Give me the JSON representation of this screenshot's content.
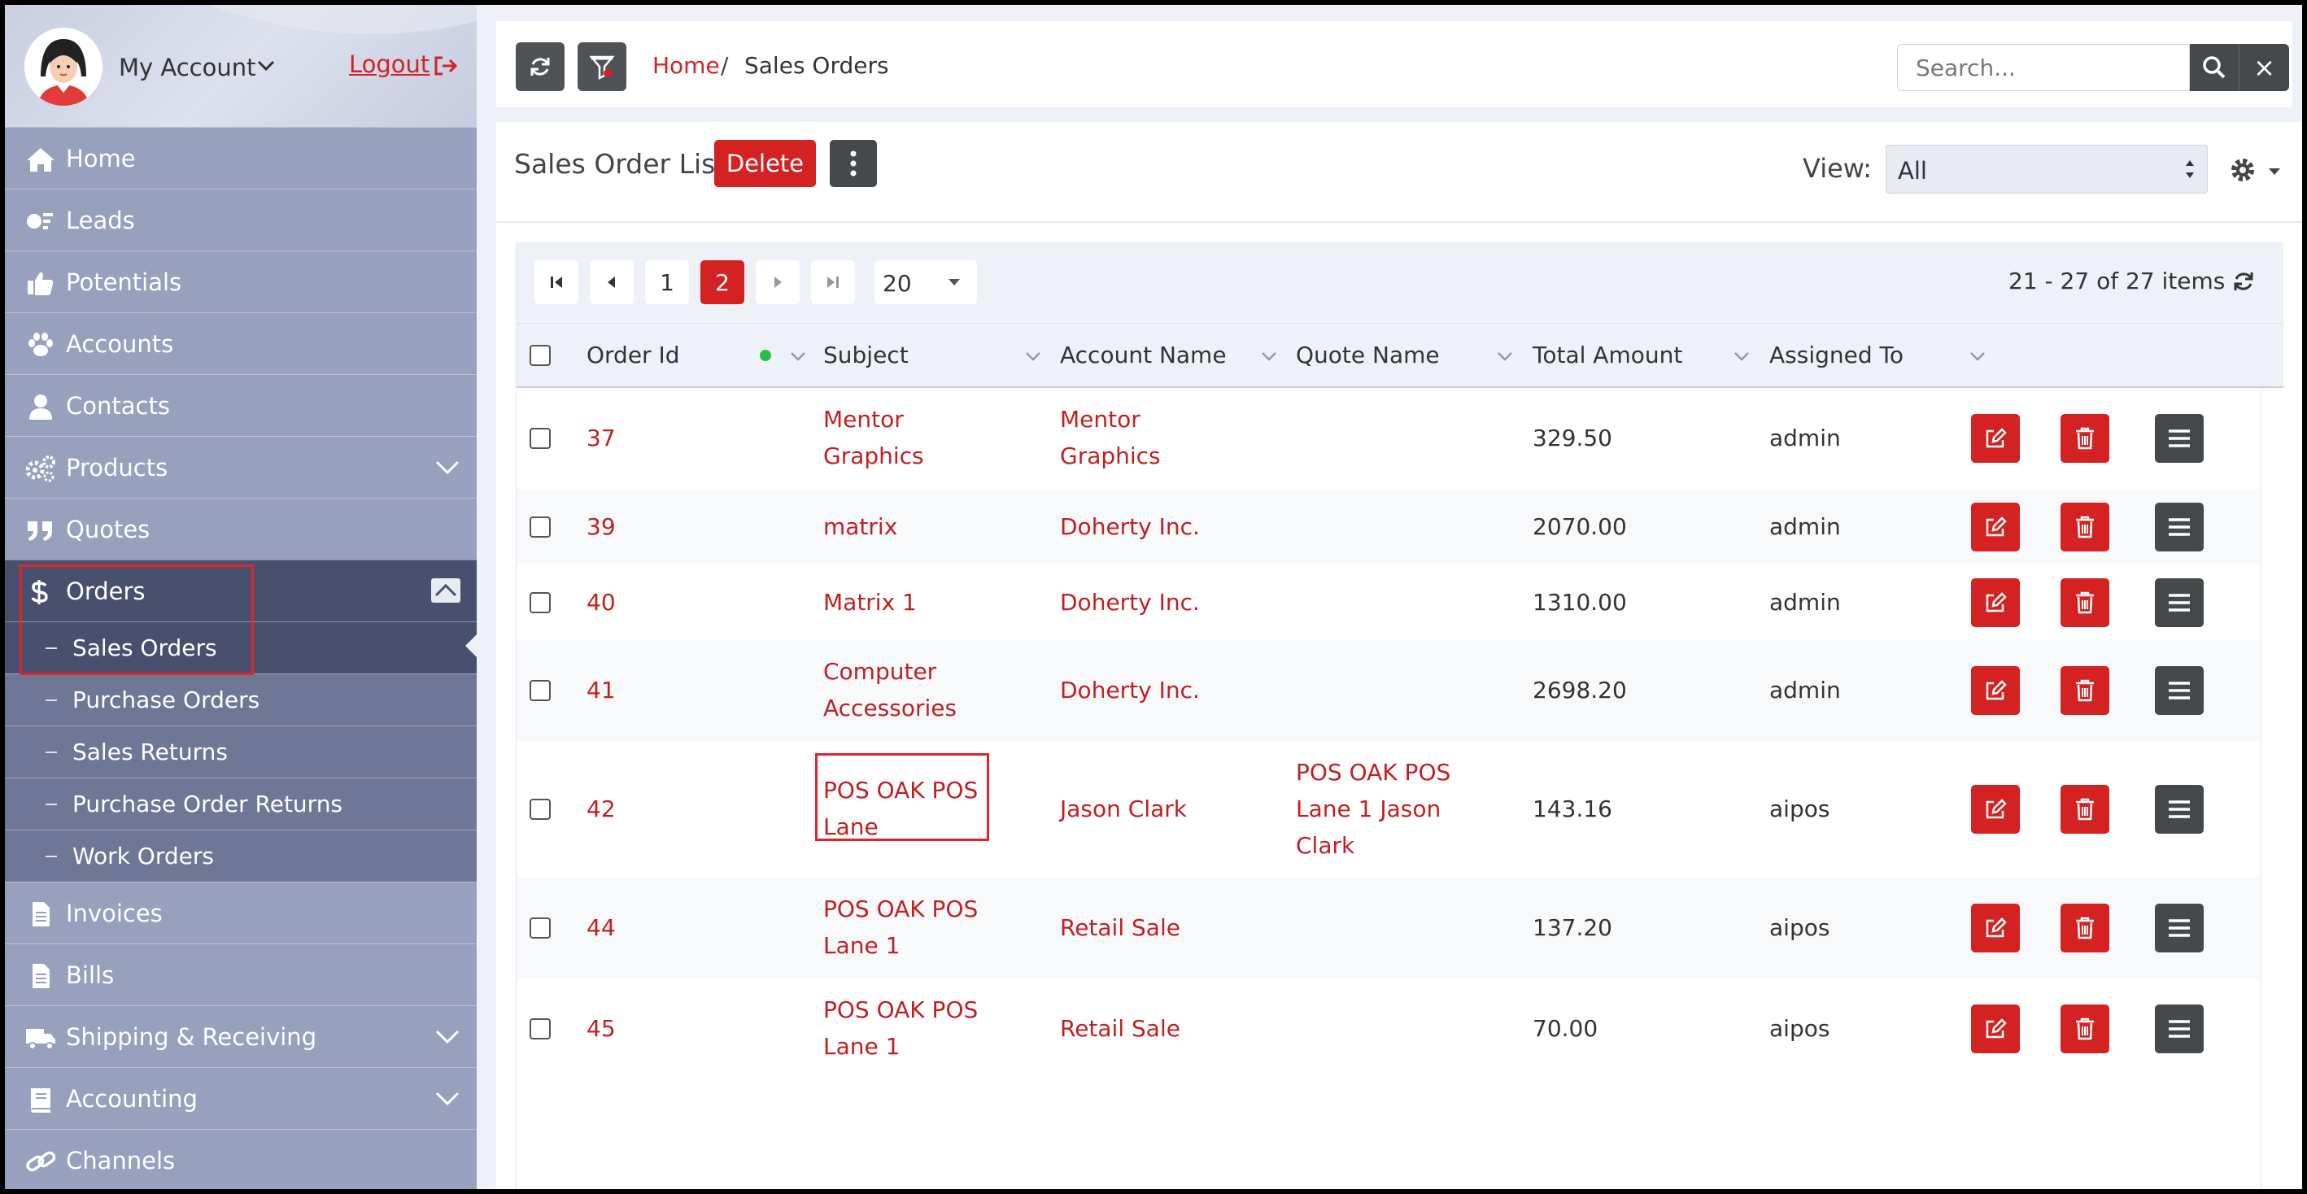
{
  "account": {
    "name": "My Account",
    "logout": "Logout"
  },
  "sidebar": {
    "items": [
      {
        "label": "Home"
      },
      {
        "label": "Leads"
      },
      {
        "label": "Potentials"
      },
      {
        "label": "Accounts"
      },
      {
        "label": "Contacts"
      },
      {
        "label": "Products"
      },
      {
        "label": "Quotes"
      },
      {
        "label": "Orders"
      },
      {
        "label": "Invoices"
      },
      {
        "label": "Bills"
      },
      {
        "label": "Shipping & Receiving"
      },
      {
        "label": "Accounting"
      },
      {
        "label": "Channels"
      }
    ],
    "orders_sub": [
      {
        "label": "Sales Orders"
      },
      {
        "label": "Purchase Orders"
      },
      {
        "label": "Sales Returns"
      },
      {
        "label": "Purchase Order Returns"
      },
      {
        "label": "Work Orders"
      }
    ]
  },
  "breadcrumb": {
    "home": "Home",
    "separator": "/",
    "current": "Sales Orders"
  },
  "search": {
    "placeholder": "Search...",
    "clear": "×"
  },
  "panel": {
    "title": "Sales Order List",
    "delete_label": "Delete",
    "view_label": "View:",
    "view_value": "All"
  },
  "pager": {
    "pages": [
      "1",
      "2"
    ],
    "current_page": "2",
    "page_size": "20",
    "items_info": "21 - 27 of 27 items"
  },
  "table": {
    "columns": [
      "Order Id",
      "Subject",
      "Account Name",
      "Quote Name",
      "Total Amount",
      "Assigned To"
    ],
    "rows": [
      {
        "id": "37",
        "subject": [
          "Mentor",
          "Graphics"
        ],
        "account": [
          "Mentor",
          "Graphics"
        ],
        "quote": [],
        "total": "329.50",
        "assigned": "admin"
      },
      {
        "id": "39",
        "subject": [
          "matrix"
        ],
        "account": [
          "Doherty Inc."
        ],
        "quote": [],
        "total": "2070.00",
        "assigned": "admin"
      },
      {
        "id": "40",
        "subject": [
          "Matrix 1"
        ],
        "account": [
          "Doherty Inc."
        ],
        "quote": [],
        "total": "1310.00",
        "assigned": "admin"
      },
      {
        "id": "41",
        "subject": [
          "Computer",
          "Accessories"
        ],
        "account": [
          "Doherty Inc."
        ],
        "quote": [],
        "total": "2698.20",
        "assigned": "admin"
      },
      {
        "id": "42",
        "subject": [
          "POS OAK POS",
          "Lane"
        ],
        "account": [
          "Jason Clark"
        ],
        "quote": [
          "POS OAK POS",
          "Lane 1 Jason",
          "Clark"
        ],
        "total": "143.16",
        "assigned": "aipos"
      },
      {
        "id": "44",
        "subject": [
          "POS OAK POS",
          "Lane 1"
        ],
        "account": [
          "Retail Sale"
        ],
        "quote": [],
        "total": "137.20",
        "assigned": "aipos"
      },
      {
        "id": "45",
        "subject": [
          "POS OAK POS",
          "Lane 1"
        ],
        "account": [
          "Retail Sale"
        ],
        "quote": [],
        "total": "70.00",
        "assigned": "aipos"
      }
    ]
  },
  "colors": {
    "accent_red": "#d42121",
    "sidebar_bg": "#97a0bd",
    "sidebar_active": "#49506e",
    "submenu_bg": "#6f7797",
    "dark_button": "#46494c",
    "status_dot": "#27c046"
  },
  "icons": {
    "sidebar": [
      "home-icon",
      "leads-icon",
      "thumbs-up-icon",
      "paw-icon",
      "user-icon",
      "gears-icon",
      "quote-icon",
      "dollar-icon",
      "file-icon",
      "file-icon",
      "truck-icon",
      "book-icon",
      "link-icon"
    ],
    "row_actions": [
      "edit-icon",
      "trash-icon",
      "menu-icon"
    ]
  }
}
